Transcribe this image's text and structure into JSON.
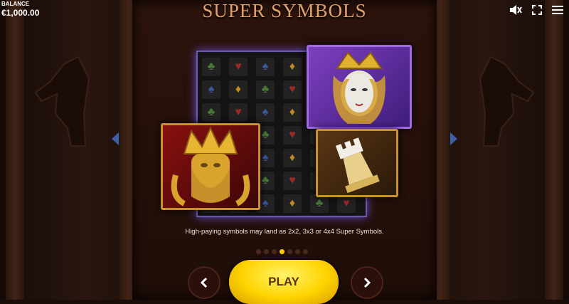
{
  "hud": {
    "balance_label": "BALANCE",
    "balance_value": "€1,000.00",
    "icons": [
      "sound-off-icon",
      "fullscreen-icon",
      "menu-icon"
    ]
  },
  "screen": {
    "title": "SUPER SYMBOLS",
    "description": "High-paying symbols may land as 2x2, 3x3 or 4x4 Super Symbols.",
    "page_count": 7,
    "active_page": 3
  },
  "symbols": [
    "queen",
    "king",
    "rook",
    "club",
    "heart",
    "spade",
    "diamond"
  ],
  "buttons": {
    "play_label": "PLAY",
    "prev_icon": "chevron-left-icon",
    "next_icon": "chevron-right-icon"
  },
  "colors": {
    "play_button": "#ffd400",
    "title": "#e0a26a",
    "active_dot": "#ffcc00",
    "glow": "#6a50d8"
  }
}
